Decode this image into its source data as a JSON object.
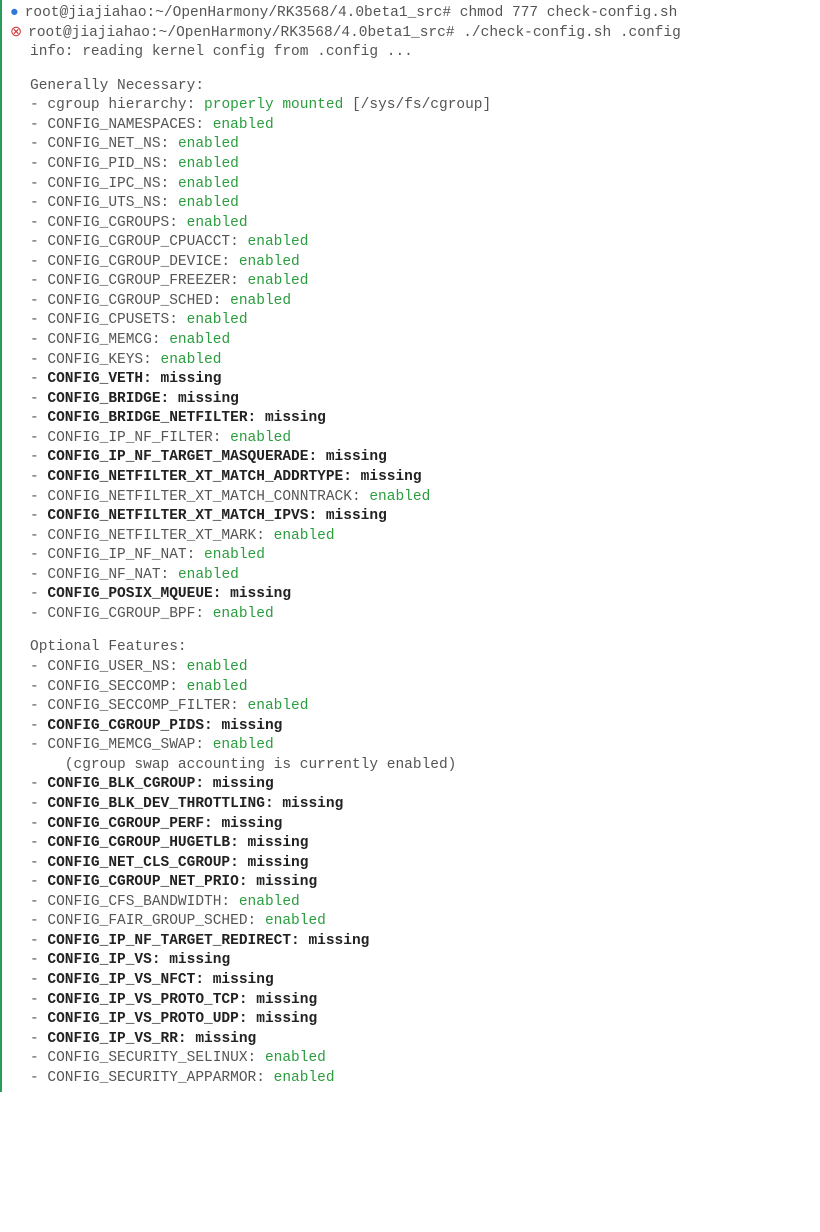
{
  "cmd1_prompt": "root@jiajiahao:~/OpenHarmony/RK3568/4.0beta1_src# ",
  "cmd1_text": "chmod 777 check-config.sh",
  "cmd2_prompt": "root@jiajiahao:~/OpenHarmony/RK3568/4.0beta1_src# ",
  "cmd2_text": "./check-config.sh .config",
  "info_line": "info: reading kernel config from .config ...",
  "section_general": "Generally Necessary:",
  "gen_rows": [
    {
      "label": "cgroup hierarchy: ",
      "status": "properly mounted",
      "status_class": "green",
      "suffix": " [/sys/fs/cgroup]",
      "bold": false
    },
    {
      "label": "CONFIG_NAMESPACES: ",
      "status": "enabled",
      "status_class": "green",
      "suffix": "",
      "bold": false
    },
    {
      "label": "CONFIG_NET_NS: ",
      "status": "enabled",
      "status_class": "green",
      "suffix": "",
      "bold": false
    },
    {
      "label": "CONFIG_PID_NS: ",
      "status": "enabled",
      "status_class": "green",
      "suffix": "",
      "bold": false
    },
    {
      "label": "CONFIG_IPC_NS: ",
      "status": "enabled",
      "status_class": "green",
      "suffix": "",
      "bold": false
    },
    {
      "label": "CONFIG_UTS_NS: ",
      "status": "enabled",
      "status_class": "green",
      "suffix": "",
      "bold": false
    },
    {
      "label": "CONFIG_CGROUPS: ",
      "status": "enabled",
      "status_class": "green",
      "suffix": "",
      "bold": false
    },
    {
      "label": "CONFIG_CGROUP_CPUACCT: ",
      "status": "enabled",
      "status_class": "green",
      "suffix": "",
      "bold": false
    },
    {
      "label": "CONFIG_CGROUP_DEVICE: ",
      "status": "enabled",
      "status_class": "green",
      "suffix": "",
      "bold": false
    },
    {
      "label": "CONFIG_CGROUP_FREEZER: ",
      "status": "enabled",
      "status_class": "green",
      "suffix": "",
      "bold": false
    },
    {
      "label": "CONFIG_CGROUP_SCHED: ",
      "status": "enabled",
      "status_class": "green",
      "suffix": "",
      "bold": false
    },
    {
      "label": "CONFIG_CPUSETS: ",
      "status": "enabled",
      "status_class": "green",
      "suffix": "",
      "bold": false
    },
    {
      "label": "CONFIG_MEMCG: ",
      "status": "enabled",
      "status_class": "green",
      "suffix": "",
      "bold": false
    },
    {
      "label": "CONFIG_KEYS: ",
      "status": "enabled",
      "status_class": "green",
      "suffix": "",
      "bold": false
    },
    {
      "label": "CONFIG_VETH: ",
      "status": "missing",
      "status_class": "red",
      "suffix": "",
      "bold": true
    },
    {
      "label": "CONFIG_BRIDGE: ",
      "status": "missing",
      "status_class": "red",
      "suffix": "",
      "bold": true
    },
    {
      "label": "CONFIG_BRIDGE_NETFILTER: ",
      "status": "missing",
      "status_class": "red",
      "suffix": "",
      "bold": true
    },
    {
      "label": "CONFIG_IP_NF_FILTER: ",
      "status": "enabled",
      "status_class": "green",
      "suffix": "",
      "bold": false
    },
    {
      "label": "CONFIG_IP_NF_TARGET_MASQUERADE: ",
      "status": "missing",
      "status_class": "red",
      "suffix": "",
      "bold": true
    },
    {
      "label": "CONFIG_NETFILTER_XT_MATCH_ADDRTYPE: ",
      "status": "missing",
      "status_class": "red",
      "suffix": "",
      "bold": true
    },
    {
      "label": "CONFIG_NETFILTER_XT_MATCH_CONNTRACK: ",
      "status": "enabled",
      "status_class": "green",
      "suffix": "",
      "bold": false
    },
    {
      "label": "CONFIG_NETFILTER_XT_MATCH_IPVS: ",
      "status": "missing",
      "status_class": "red",
      "suffix": "",
      "bold": true
    },
    {
      "label": "CONFIG_NETFILTER_XT_MARK: ",
      "status": "enabled",
      "status_class": "green",
      "suffix": "",
      "bold": false
    },
    {
      "label": "CONFIG_IP_NF_NAT: ",
      "status": "enabled",
      "status_class": "green",
      "suffix": "",
      "bold": false
    },
    {
      "label": "CONFIG_NF_NAT: ",
      "status": "enabled",
      "status_class": "green",
      "suffix": "",
      "bold": false
    },
    {
      "label": "CONFIG_POSIX_MQUEUE: ",
      "status": "missing",
      "status_class": "red",
      "suffix": "",
      "bold": true
    },
    {
      "label": "CONFIG_CGROUP_BPF: ",
      "status": "enabled",
      "status_class": "green",
      "suffix": "",
      "bold": false
    }
  ],
  "section_optional": "Optional Features:",
  "opt_rows": [
    {
      "label": "CONFIG_USER_NS: ",
      "status": "enabled",
      "status_class": "green",
      "suffix": "",
      "bold": false
    },
    {
      "label": "CONFIG_SECCOMP: ",
      "status": "enabled",
      "status_class": "green",
      "suffix": "",
      "bold": false
    },
    {
      "label": "CONFIG_SECCOMP_FILTER: ",
      "status": "enabled",
      "status_class": "green",
      "suffix": "",
      "bold": false
    },
    {
      "label": "CONFIG_CGROUP_PIDS: ",
      "status": "missing",
      "status_class": "red",
      "suffix": "",
      "bold": true
    },
    {
      "label": "CONFIG_MEMCG_SWAP: ",
      "status": "enabled",
      "status_class": "green",
      "suffix": "",
      "bold": false
    }
  ],
  "swap_note": "    (cgroup swap accounting is currently enabled)",
  "opt_rows2": [
    {
      "label": "CONFIG_BLK_CGROUP: ",
      "status": "missing",
      "status_class": "red",
      "suffix": "",
      "bold": true
    },
    {
      "label": "CONFIG_BLK_DEV_THROTTLING: ",
      "status": "missing",
      "status_class": "red",
      "suffix": "",
      "bold": true
    },
    {
      "label": "CONFIG_CGROUP_PERF: ",
      "status": "missing",
      "status_class": "red",
      "suffix": "",
      "bold": true
    },
    {
      "label": "CONFIG_CGROUP_HUGETLB: ",
      "status": "missing",
      "status_class": "red",
      "suffix": "",
      "bold": true
    },
    {
      "label": "CONFIG_NET_CLS_CGROUP: ",
      "status": "missing",
      "status_class": "red",
      "suffix": "",
      "bold": true
    },
    {
      "label": "CONFIG_CGROUP_NET_PRIO: ",
      "status": "missing",
      "status_class": "red",
      "suffix": "",
      "bold": true
    },
    {
      "label": "CONFIG_CFS_BANDWIDTH: ",
      "status": "enabled",
      "status_class": "green",
      "suffix": "",
      "bold": false
    },
    {
      "label": "CONFIG_FAIR_GROUP_SCHED: ",
      "status": "enabled",
      "status_class": "green",
      "suffix": "",
      "bold": false
    },
    {
      "label": "CONFIG_IP_NF_TARGET_REDIRECT: ",
      "status": "missing",
      "status_class": "red",
      "suffix": "",
      "bold": true
    },
    {
      "label": "CONFIG_IP_VS: ",
      "status": "missing",
      "status_class": "red",
      "suffix": "",
      "bold": true
    },
    {
      "label": "CONFIG_IP_VS_NFCT: ",
      "status": "missing",
      "status_class": "red",
      "suffix": "",
      "bold": true
    },
    {
      "label": "CONFIG_IP_VS_PROTO_TCP: ",
      "status": "missing",
      "status_class": "red",
      "suffix": "",
      "bold": true
    },
    {
      "label": "CONFIG_IP_VS_PROTO_UDP: ",
      "status": "missing",
      "status_class": "red",
      "suffix": "",
      "bold": true
    },
    {
      "label": "CONFIG_IP_VS_RR: ",
      "status": "missing",
      "status_class": "red",
      "suffix": "",
      "bold": true
    },
    {
      "label": "CONFIG_SECURITY_SELINUX: ",
      "status": "enabled",
      "status_class": "green",
      "suffix": "",
      "bold": false
    },
    {
      "label": "CONFIG_SECURITY_APPARMOR: ",
      "status": "enabled",
      "status_class": "green",
      "suffix": "",
      "bold": false
    }
  ]
}
